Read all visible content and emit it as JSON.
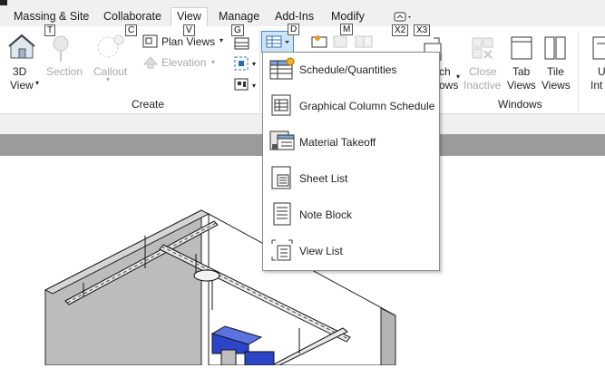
{
  "tabs": [
    {
      "label": "Massing & Site"
    },
    {
      "label": "Collaborate"
    },
    {
      "label": "View",
      "active": true
    },
    {
      "label": "Manage"
    },
    {
      "label": "Add-Ins"
    },
    {
      "label": "Modify"
    }
  ],
  "keytips": {
    "section": "T",
    "callout": "C",
    "plan_views": "V",
    "sheet": "G",
    "schedules": "D",
    "legends": "M",
    "switch": "X2",
    "close": "X3"
  },
  "ribbon": {
    "view3d_line1": "3D",
    "view3d_line2": "View",
    "section": "Section",
    "callout": "Callout",
    "plan_views": "Plan  Views",
    "elevation": "Elevation",
    "switch_part1": "ch",
    "switch_part2": "ows",
    "close_line1": "Close",
    "close_line2": "Inactive",
    "tab_line1": "Tab",
    "tab_line2": "Views",
    "tile_line1": "Tile",
    "tile_line2": "Views",
    "ui_line1": "U",
    "ui_line2": "Int",
    "panel_create": "Create",
    "panel_windows": "Windows"
  },
  "schedules_menu": {
    "items": [
      {
        "label": "Schedule/Quantities",
        "icon": "schedule-quantities-icon"
      },
      {
        "label": "Graphical Column Schedule",
        "icon": "graphical-column-schedule-icon"
      },
      {
        "label": "Material Takeoff",
        "icon": "material-takeoff-icon"
      },
      {
        "label": "Sheet List",
        "icon": "sheet-list-icon"
      },
      {
        "label": "Note Block",
        "icon": "note-block-icon"
      },
      {
        "label": "View List",
        "icon": "view-list-icon"
      }
    ]
  },
  "colors": {
    "accent": "#3c8ad8",
    "selected_bg": "#cde4f7",
    "wall": "#b4b4b4",
    "equipment_blue": "#2c45c8"
  }
}
